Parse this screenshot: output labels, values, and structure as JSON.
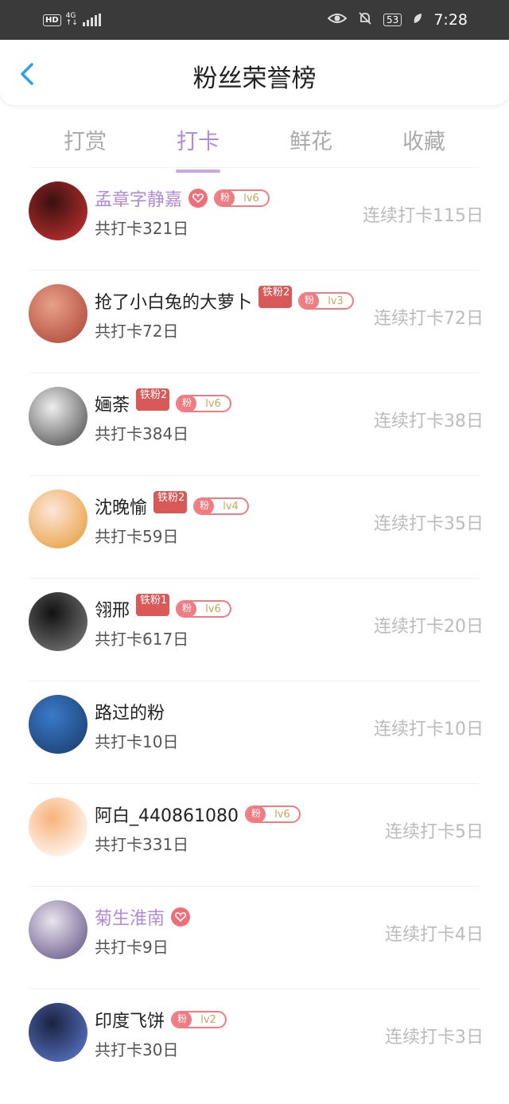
{
  "status": {
    "hd": "HD",
    "net": "4G",
    "battery": "53",
    "time": "7:28"
  },
  "header": {
    "title": "粉丝荣誉榜"
  },
  "tabs": [
    {
      "label": "打赏",
      "active": false
    },
    {
      "label": "打卡",
      "active": true
    },
    {
      "label": "鲜花",
      "active": false
    },
    {
      "label": "收藏",
      "active": false
    }
  ],
  "rows": [
    {
      "name": "孟章字静嘉",
      "vip": true,
      "heart": true,
      "tiefen": "",
      "fen": "粉",
      "level": "lv6",
      "total": "共打卡321日",
      "streak": "连续打卡115日",
      "avatar": [
        "#3a1010",
        "#c03030"
      ]
    },
    {
      "name": "抢了小白兔的大萝卜",
      "vip": false,
      "heart": false,
      "tiefen": "铁粉2",
      "fen": "粉",
      "level": "lv3",
      "total": "共打卡72日",
      "streak": "连续打卡72日",
      "avatar": [
        "#e8a08a",
        "#b04a3a"
      ]
    },
    {
      "name": "婳荼",
      "vip": false,
      "heart": false,
      "tiefen": "铁粉2",
      "fen": "粉",
      "level": "lv6",
      "total": "共打卡384日",
      "streak": "连续打卡38日",
      "avatar": [
        "#eeeeee",
        "#555555"
      ]
    },
    {
      "name": "沈晚愉",
      "vip": false,
      "heart": false,
      "tiefen": "铁粉2",
      "fen": "粉",
      "level": "lv4",
      "total": "共打卡59日",
      "streak": "连续打卡35日",
      "avatar": [
        "#fde6d8",
        "#e8a040"
      ]
    },
    {
      "name": "翎邢",
      "vip": false,
      "heart": false,
      "tiefen": "铁粉1",
      "fen": "粉",
      "level": "lv6",
      "total": "共打卡617日",
      "streak": "连续打卡20日",
      "avatar": [
        "#111111",
        "#777777"
      ]
    },
    {
      "name": "路过的粉",
      "vip": false,
      "heart": false,
      "tiefen": "",
      "fen": "",
      "level": "",
      "total": "共打卡10日",
      "streak": "连续打卡10日",
      "avatar": [
        "#3a7ac8",
        "#1c3f70"
      ]
    },
    {
      "name": "阿白_440861080",
      "vip": false,
      "heart": false,
      "tiefen": "",
      "fen": "粉",
      "level": "lv6",
      "total": "共打卡331日",
      "streak": "连续打卡5日",
      "avatar": [
        "#f7b27a",
        "#ffffff"
      ]
    },
    {
      "name": "菊生淮南",
      "vip": true,
      "heart": true,
      "tiefen": "",
      "fen": "",
      "level": "",
      "total": "共打卡9日",
      "streak": "连续打卡4日",
      "avatar": [
        "#e9e4ef",
        "#6a5a8a"
      ]
    },
    {
      "name": "印度飞饼",
      "vip": false,
      "heart": false,
      "tiefen": "",
      "fen": "粉",
      "level": "lv2",
      "total": "共打卡30日",
      "streak": "连续打卡3日",
      "avatar": [
        "#1a2340",
        "#5a74c8"
      ]
    }
  ]
}
